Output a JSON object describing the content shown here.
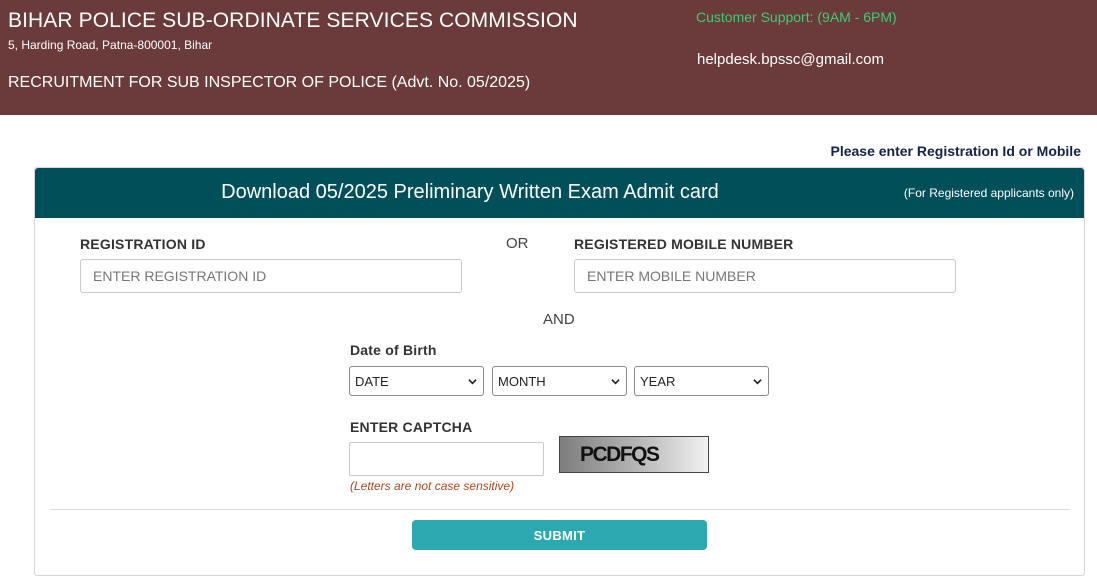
{
  "header": {
    "org_title": "BIHAR POLICE SUB-ORDINATE SERVICES COMMISSION",
    "address": "5, Harding Road, Patna-800001, Bihar",
    "recruitment_title": "RECRUITMENT FOR SUB INSPECTOR OF POLICE (Advt. No. 05/2025)",
    "support_text": "Customer Support: (9AM - 6PM)",
    "email": "helpdesk.bpssc@gmail.com",
    "colors": {
      "background": "#6b3a3a",
      "support_text": "#3fca74"
    }
  },
  "instruction": "Please enter Registration Id or Mobile",
  "card": {
    "title": "Download 05/2025 Preliminary Written Exam Admit card",
    "note": "(For Registered applicants only)",
    "header_color": "#004f59"
  },
  "form": {
    "registration_label": "REGISTRATION ID",
    "registration_placeholder": "ENTER REGISTRATION ID",
    "or_text": "OR",
    "mobile_label": "REGISTERED MOBILE NUMBER",
    "mobile_placeholder": "ENTER MOBILE NUMBER",
    "and_text": "AND",
    "dob_label": "Date of Birth",
    "dob_date": "DATE",
    "dob_month": "MONTH",
    "dob_year": "YEAR",
    "captcha_label": "ENTER CAPTCHA",
    "captcha_value": "",
    "captcha_image_text": "PCDFQS",
    "captcha_hint": "(Letters are not case sensitive)",
    "submit_label": "SUBMIT",
    "submit_color": "#2ba8b0",
    "hint_color": "#b5471a"
  }
}
